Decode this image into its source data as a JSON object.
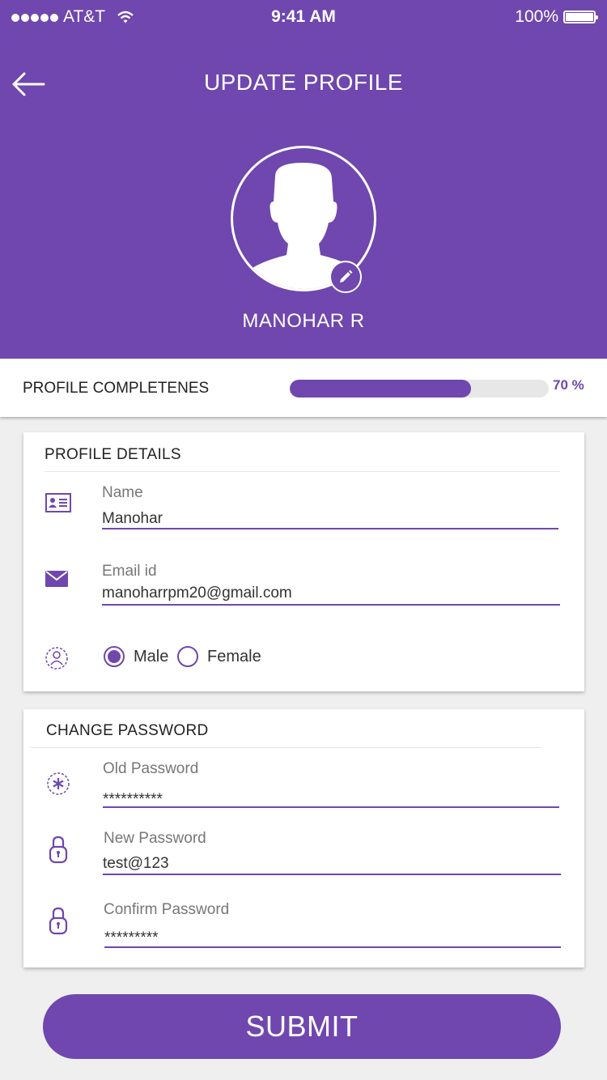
{
  "status_bar": {
    "carrier": "AT&T",
    "time": "9:41 AM",
    "battery": "100%"
  },
  "header": {
    "title": "UPDATE PROFILE",
    "user_name": "MANOHAR R"
  },
  "completeness": {
    "label": "PROFILE COMPLETENES",
    "percent_text": "70 %",
    "percent": 0.7
  },
  "profile_details": {
    "title": "PROFILE DETAILS",
    "name_label": "Name",
    "name_value": "Manohar",
    "email_label": "Email id",
    "email_value": "manoharrpm20@gmail.com",
    "gender_options": [
      "Male",
      "Female"
    ],
    "gender_selected": "Male"
  },
  "change_password": {
    "title": "CHANGE PASSWORD",
    "old_label": "Old Password",
    "old_value": "**********",
    "new_label": "New Password",
    "new_value": "test@123",
    "confirm_label": "Confirm Password",
    "confirm_value": "*********"
  },
  "submit_label": "SUBMIT",
  "colors": {
    "accent": "#6f47ae",
    "background": "#efefef",
    "card": "#ffffff"
  }
}
